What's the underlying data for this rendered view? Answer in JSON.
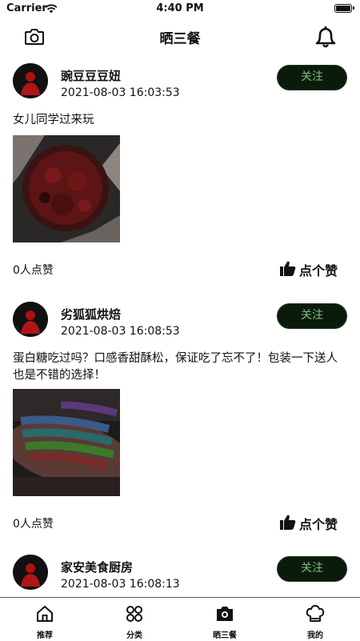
{
  "status_bar": {
    "carrier": "Carrier",
    "time": "4:40 PM"
  },
  "header": {
    "title": "晒三餐",
    "left_icon": "camera-icon",
    "right_icon": "bell-icon"
  },
  "colors": {
    "follow_bg": "#0c1a0c",
    "follow_text": "#7bc27b",
    "follow_border": "#1a3a1a"
  },
  "posts": [
    {
      "username": "豌豆豆豆妞",
      "time": "2021-08-03 16:03:53",
      "follow_label": "关注",
      "text": "女儿同学过来玩",
      "image": "dark-red-cake-photo",
      "like_count": "0人点赞",
      "like_label": "点个赞"
    },
    {
      "username": "劣狐狐烘焙",
      "time": "2021-08-03 16:08:53",
      "follow_label": "关注",
      "text": "蛋白糖吃过吗？口感香甜酥松，保证吃了忘不了！包装一下送人也是不错的选择！",
      "image": "colorful-meringue-sticks-photo",
      "like_count": "0人点赞",
      "like_label": "点个赞"
    },
    {
      "username": "家安美食厨房",
      "time": "2021-08-03 16:08:13",
      "follow_label": "关注"
    }
  ],
  "tabbar": {
    "items": [
      {
        "label": "推荐",
        "icon": "home-icon"
      },
      {
        "label": "分类",
        "icon": "category-icon"
      },
      {
        "label": "晒三餐",
        "icon": "camera-icon",
        "active": true
      },
      {
        "label": "我的",
        "icon": "chef-hat-icon"
      }
    ]
  }
}
